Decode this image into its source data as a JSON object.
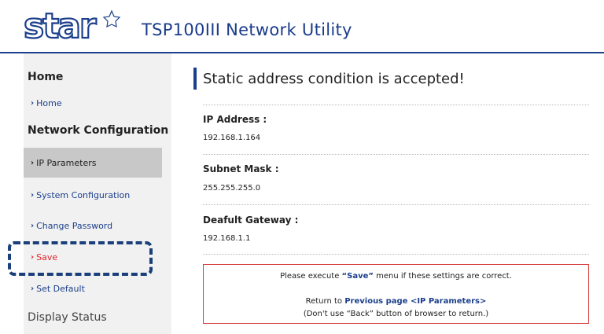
{
  "header": {
    "logo_text": "star",
    "title": "TSP100III Network Utility"
  },
  "sidebar": {
    "sections": [
      {
        "label": "Home"
      },
      {
        "label": "Network Configuration"
      },
      {
        "label": "Display Status"
      }
    ],
    "items": [
      {
        "label": "Home"
      },
      {
        "label": "IP Parameters"
      },
      {
        "label": "System Configuration"
      },
      {
        "label": "Change Password"
      },
      {
        "label": "Save"
      },
      {
        "label": "Set Default"
      }
    ],
    "chevron": "›"
  },
  "main": {
    "title": "Static address condition is accepted!",
    "fields": [
      {
        "label": "IP Address :",
        "value": "192.168.1.164"
      },
      {
        "label": "Subnet Mask :",
        "value": "255.255.255.0"
      },
      {
        "label": "Deafult Gateway :",
        "value": "192.168.1.1"
      }
    ],
    "notice": {
      "line1_prefix": "Please execute ",
      "line1_save": "“Save”",
      "line1_suffix": " menu if these settings are correct.",
      "line2_prefix": "Return to ",
      "line2_link": "Previous page <IP Parameters>",
      "line3": "(Don't use “Back” button of browser to return.)"
    }
  },
  "colors": {
    "brand_blue": "#1c3f8c",
    "save_red": "#e0242c",
    "active_item_bg": "#c8c8c8",
    "sidebar_bg": "#f1f1f1"
  }
}
